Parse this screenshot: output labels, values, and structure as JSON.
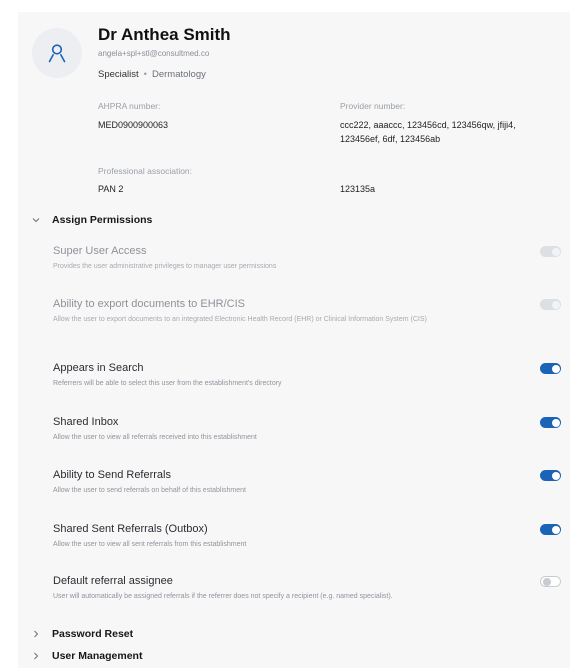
{
  "profile": {
    "name": "Dr Anthea Smith",
    "email": "angela+spl+stl@consultmed.co",
    "role": "Specialist",
    "separator": "•",
    "specialty": "Dermatology",
    "ahpra_label": "AHPRA number:",
    "ahpra_value": "MED0900900063",
    "provider_label": "Provider number:",
    "provider_value_line1": "ccc222, aaaccc, 123456cd, 123456qw, jfiji4,",
    "provider_value_line2": "123456ef, 6df, 123456ab",
    "association_label": "Professional association:",
    "association_value": "PAN 2",
    "association_number": "123135a"
  },
  "sections": {
    "assign_permissions": "Assign Permissions",
    "password_reset": "Password Reset",
    "user_management": "User Management"
  },
  "permissions": [
    {
      "title": "Super User Access",
      "description": "Provides the user administrative privileges to manager user permissions",
      "state": "disabled"
    },
    {
      "title": "Ability to export documents to EHR/CIS",
      "description": "Allow the user to export documents to an integrated Electronic Health Record (EHR) or Clinical Information System (CIS)",
      "state": "disabled"
    },
    {
      "title": "Appears in Search",
      "description": "Referrers will be able to select this user from the establishment's directory",
      "state": "on"
    },
    {
      "title": "Shared Inbox",
      "description": "Allow the user to view all referrals received into this establishment",
      "state": "on"
    },
    {
      "title": "Ability to Send Referrals",
      "description": "Allow the user to send referrals on behalf of this establishment",
      "state": "on"
    },
    {
      "title": "Shared Sent Referrals (Outbox)",
      "description": "Allow the user to view all sent referrals from this establishment",
      "state": "on"
    },
    {
      "title": "Default referral assignee",
      "description": "User will automatically be assigned referrals if the referrer does not specify a recipient (e.g. named specialist).",
      "state": "off"
    }
  ],
  "colors": {
    "toggle_on": "#1b63b6",
    "toggle_disabled": "#dcdfe3",
    "panel_background": "#f7f7f8"
  },
  "icons": {
    "avatar": "user-icon",
    "expanded": "chevron-down-icon",
    "collapsed": "chevron-right-icon"
  }
}
